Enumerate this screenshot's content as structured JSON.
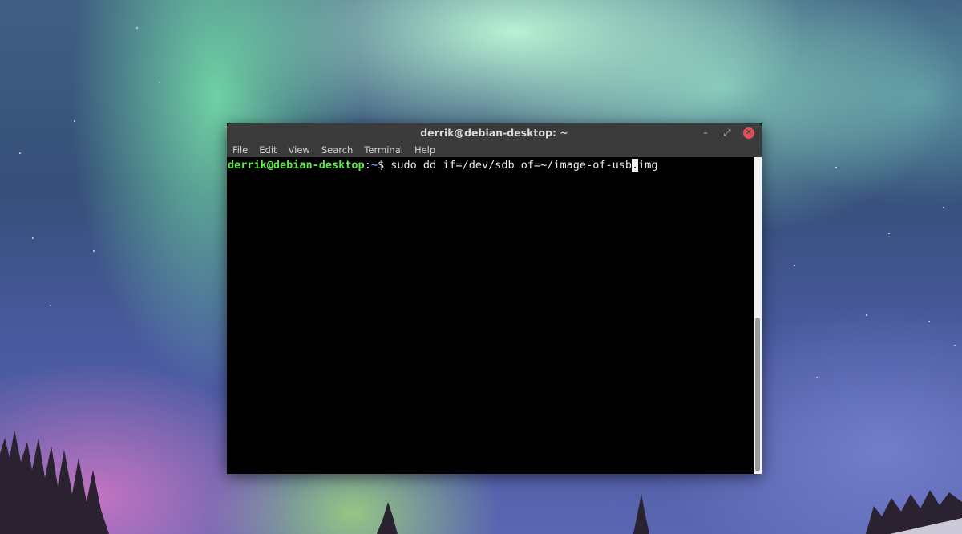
{
  "window": {
    "title": "derrik@debian-desktop: ~",
    "controls": {
      "minimize_symbol": "–",
      "maximize_symbol": "⤢",
      "close_symbol": "✕"
    }
  },
  "menubar": {
    "items": [
      "File",
      "Edit",
      "View",
      "Search",
      "Terminal",
      "Help"
    ]
  },
  "terminal": {
    "prompt_user_host": "derrik@debian-desktop",
    "prompt_colon": ":",
    "prompt_path": "~",
    "prompt_sign": "$ ",
    "command_before_cursor": "sudo dd if=/dev/sdb of=~/image-of-usb",
    "cursor_char": ".",
    "command_after_cursor": "img",
    "colors": {
      "user_host": "#5ee64a",
      "path": "#6c8cf0",
      "text": "#e8e8e8",
      "background": "#000000"
    }
  },
  "icons": {
    "minimize": "minimize-icon",
    "maximize": "maximize-icon",
    "close": "close-icon"
  }
}
